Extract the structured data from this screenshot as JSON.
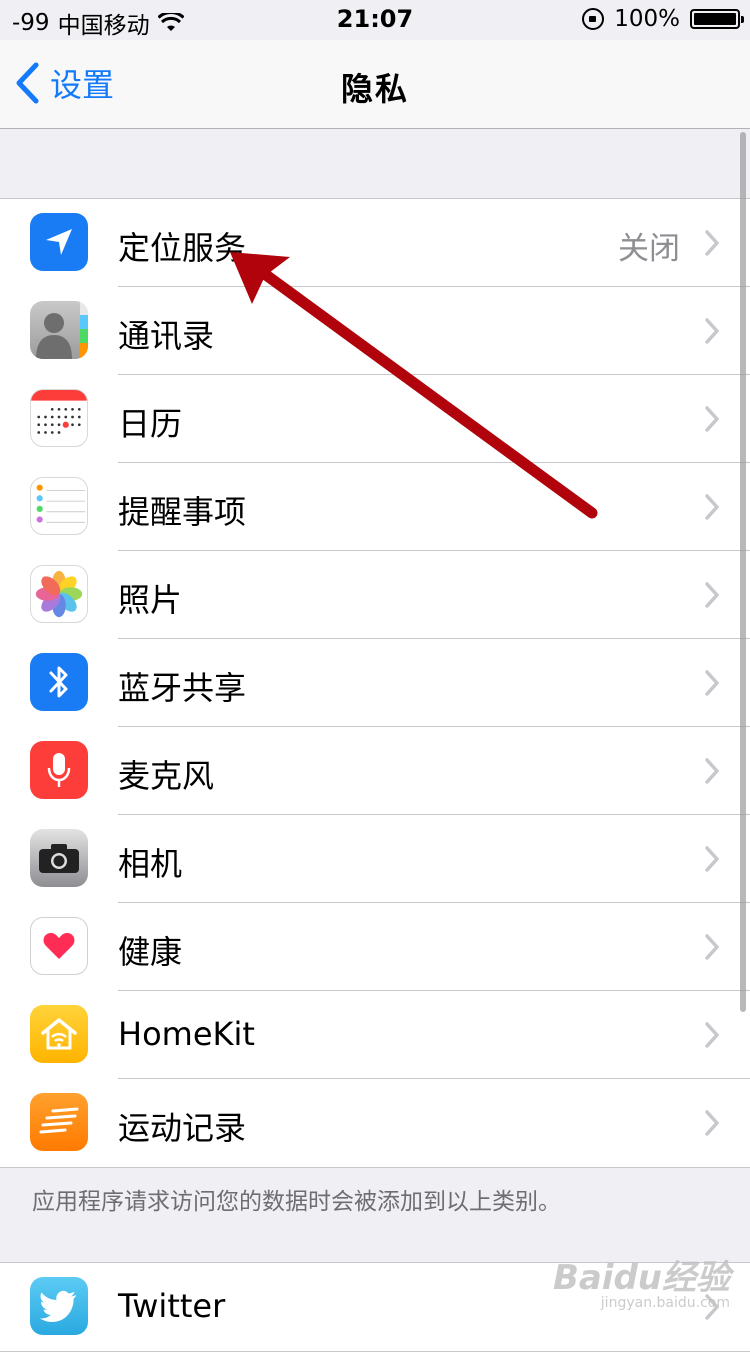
{
  "status_bar": {
    "signal": "-99",
    "carrier": "中国移动",
    "time": "21:07",
    "battery_percent": "100%"
  },
  "nav": {
    "back_label": "设置",
    "title": "隐私"
  },
  "privacy_items": [
    {
      "label": "定位服务",
      "value": "关闭",
      "icon": "location-arrow-icon",
      "color": "#1a7cf4"
    },
    {
      "label": "通讯录",
      "value": "",
      "icon": "contacts-icon",
      "color": "#9b9b9b"
    },
    {
      "label": "日历",
      "value": "",
      "icon": "calendar-icon",
      "color": "#ffffff"
    },
    {
      "label": "提醒事项",
      "value": "",
      "icon": "reminders-icon",
      "color": "#ffffff"
    },
    {
      "label": "照片",
      "value": "",
      "icon": "photos-icon",
      "color": "#ffffff"
    },
    {
      "label": "蓝牙共享",
      "value": "",
      "icon": "bluetooth-icon",
      "color": "#1a7cf4"
    },
    {
      "label": "麦克风",
      "value": "",
      "icon": "microphone-icon",
      "color": "#fc3d39"
    },
    {
      "label": "相机",
      "value": "",
      "icon": "camera-icon",
      "color": "#8e8e93"
    },
    {
      "label": "健康",
      "value": "",
      "icon": "heart-icon",
      "color": "#ffffff"
    },
    {
      "label": "HomeKit",
      "value": "",
      "icon": "homekit-icon",
      "color": "#ffc107"
    },
    {
      "label": "运动记录",
      "value": "",
      "icon": "motion-icon",
      "color": "#ff8c00"
    }
  ],
  "footer_note": "应用程序请求访问您的数据时会被添加到以上类别。",
  "social_items": [
    {
      "label": "Twitter",
      "icon": "twitter-icon",
      "color": "#2aa9e0"
    }
  ],
  "watermark": {
    "brand": "Baidu经验",
    "url": "jingyan.baidu.com"
  },
  "colors": {
    "accent": "#127afb",
    "background": "#efeff4",
    "annotation_arrow": "#b0030b"
  }
}
